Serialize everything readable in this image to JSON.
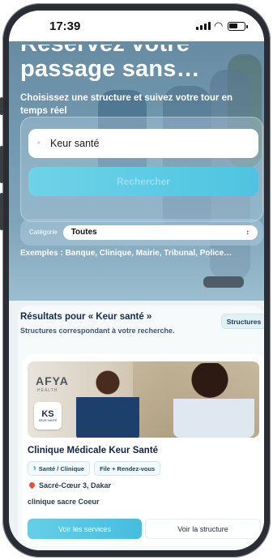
{
  "status_bar": {
    "time": "17:39"
  },
  "hero": {
    "title_partial": "Réservez votre",
    "title": "passage sans…",
    "subtitle": "Choisissez une structure et suivez votre tour en temps réel"
  },
  "search": {
    "value": "Keur santé",
    "button_label": "Rechercher",
    "icon": "search-icon"
  },
  "filter": {
    "label": "Catégorie",
    "selected": "Toutes"
  },
  "examples": "Exemples : Banque, Clinique, Mairie, Tribunal, Police…",
  "results": {
    "title": "Résultats pour « Keur santé »",
    "subtitle": "Structures correspondant à votre recherche.",
    "chip": "Structures",
    "cards": [
      {
        "image_brand": "AFYA",
        "image_brand_sub": "HEALTH",
        "logo_text": "KS",
        "logo_sub": "KEUR SANTÉ",
        "name": "Clinique Médicale Keur Santé",
        "tags": [
          "Santé / Clinique",
          "File + Rendez-vous"
        ],
        "address": "Sacré-Cœur 3, Dakar",
        "description": "clinique sacre Coeur",
        "primary_button": "Voir les services",
        "secondary_button": "Voir la structure"
      }
    ]
  },
  "colors": {
    "accent": "#4ec4e2",
    "text_dark": "#0e2442",
    "pin": "#e2503f"
  }
}
